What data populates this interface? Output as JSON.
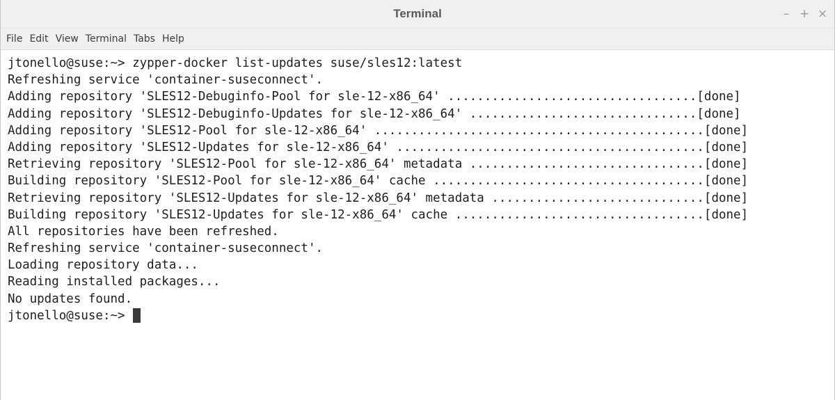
{
  "window": {
    "title": "Terminal",
    "controls": {
      "minimize": "–",
      "maximize": "+",
      "close": "×"
    }
  },
  "menubar": {
    "items": [
      "File",
      "Edit",
      "View",
      "Terminal",
      "Tabs",
      "Help"
    ]
  },
  "terminal": {
    "lines": [
      "jtonello@suse:~> zypper-docker list-updates suse/sles12:latest",
      "Refreshing service 'container-suseconnect'.",
      "Adding repository 'SLES12-Debuginfo-Pool for sle-12-x86_64' ..................................[done]",
      "Adding repository 'SLES12-Debuginfo-Updates for sle-12-x86_64' ...............................[done]",
      "Adding repository 'SLES12-Pool for sle-12-x86_64' .............................................[done]",
      "Adding repository 'SLES12-Updates for sle-12-x86_64' ..........................................[done]",
      "Retrieving repository 'SLES12-Pool for sle-12-x86_64' metadata ................................[done]",
      "Building repository 'SLES12-Pool for sle-12-x86_64' cache .....................................[done]",
      "Retrieving repository 'SLES12-Updates for sle-12-x86_64' metadata .............................[done]",
      "Building repository 'SLES12-Updates for sle-12-x86_64' cache ..................................[done]",
      "All repositories have been refreshed.",
      "Refreshing service 'container-suseconnect'.",
      "Loading repository data...",
      "Reading installed packages...",
      "No updates found."
    ],
    "prompt": "jtonello@suse:~> "
  }
}
